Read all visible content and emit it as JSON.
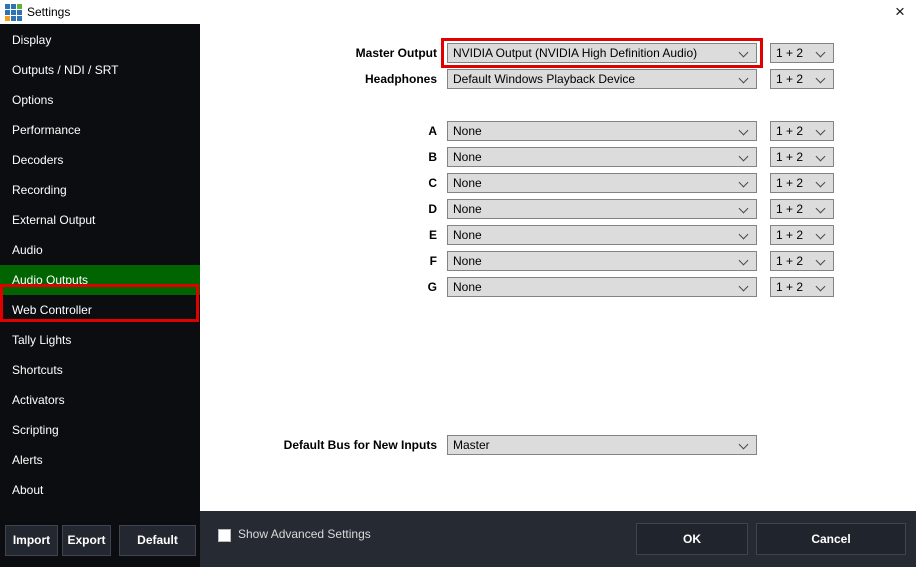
{
  "titlebar": {
    "title": "Settings",
    "close_glyph": "×"
  },
  "sidebar": {
    "items": [
      {
        "label": "Display"
      },
      {
        "label": "Outputs / NDI / SRT"
      },
      {
        "label": "Options"
      },
      {
        "label": "Performance"
      },
      {
        "label": "Decoders"
      },
      {
        "label": "Recording"
      },
      {
        "label": "External Output"
      },
      {
        "label": "Audio"
      },
      {
        "label": "Audio Outputs",
        "selected": true,
        "highlighted": true
      },
      {
        "label": "Web Controller"
      },
      {
        "label": "Tally Lights"
      },
      {
        "label": "Shortcuts"
      },
      {
        "label": "Activators"
      },
      {
        "label": "Scripting"
      },
      {
        "label": "Alerts"
      },
      {
        "label": "About"
      }
    ],
    "import_label": "Import",
    "export_label": "Export",
    "default_label": "Default"
  },
  "main": {
    "rows": [
      {
        "label": "Master Output",
        "value": "NVIDIA Output (NVIDIA High Definition Audio)",
        "channel": "1 + 2",
        "highlighted": true
      },
      {
        "label": "Headphones",
        "value": "Default Windows Playback Device",
        "channel": "1 + 2"
      },
      {
        "label": "A",
        "value": "None",
        "channel": "1 + 2"
      },
      {
        "label": "B",
        "value": "None",
        "channel": "1 + 2"
      },
      {
        "label": "C",
        "value": "None",
        "channel": "1 + 2"
      },
      {
        "label": "D",
        "value": "None",
        "channel": "1 + 2"
      },
      {
        "label": "E",
        "value": "None",
        "channel": "1 + 2"
      },
      {
        "label": "F",
        "value": "None",
        "channel": "1 + 2"
      },
      {
        "label": "G",
        "value": "None",
        "channel": "1 + 2"
      }
    ],
    "default_bus": {
      "label": "Default Bus for New Inputs",
      "value": "Master"
    }
  },
  "footer": {
    "checkbox_label": "Show Advanced Settings",
    "checkbox_checked": false,
    "ok_label": "OK",
    "cancel_label": "Cancel"
  },
  "colors": {
    "selected_item_green": "#006400",
    "annotation_red": "#e10000",
    "sidebar_bg": "#0b0d10",
    "footer_bg": "#262a33",
    "dropdown_bg": "#dcdcdc"
  }
}
